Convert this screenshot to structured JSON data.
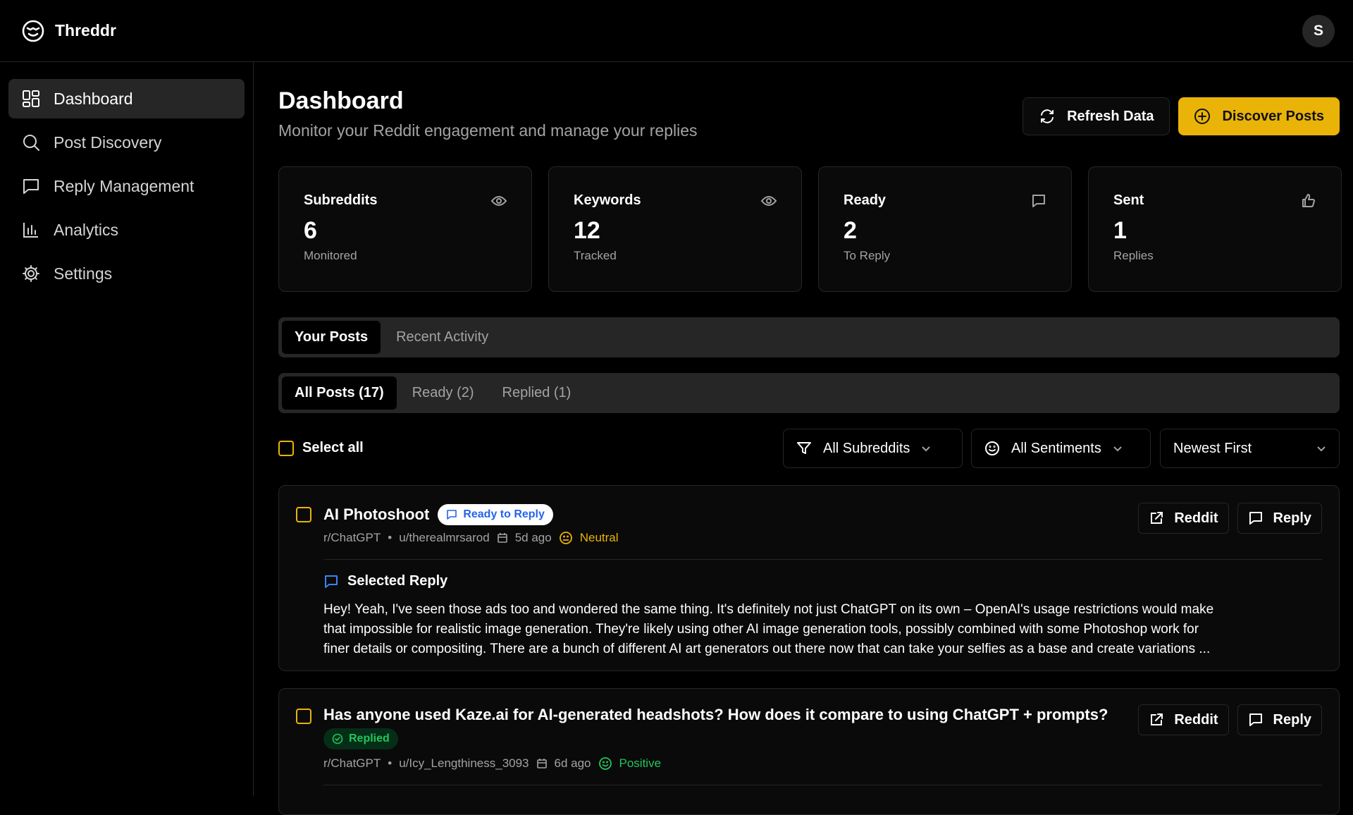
{
  "app": {
    "name": "Threddr",
    "avatar_initial": "S"
  },
  "sidebar": {
    "items": [
      {
        "label": "Dashboard",
        "icon": "dashboard-icon",
        "active": true
      },
      {
        "label": "Post Discovery",
        "icon": "search-icon"
      },
      {
        "label": "Reply Management",
        "icon": "message-icon"
      },
      {
        "label": "Analytics",
        "icon": "bar-chart-icon"
      },
      {
        "label": "Settings",
        "icon": "gear-icon"
      }
    ]
  },
  "page": {
    "title": "Dashboard",
    "subtitle": "Monitor your Reddit engagement and manage your replies",
    "refresh_label": "Refresh Data",
    "discover_label": "Discover Posts"
  },
  "stats": [
    {
      "label": "Subreddits",
      "value": "6",
      "sub": "Monitored",
      "icon": "eye-icon"
    },
    {
      "label": "Keywords",
      "value": "12",
      "sub": "Tracked",
      "icon": "eye-icon"
    },
    {
      "label": "Ready",
      "value": "2",
      "sub": "To Reply",
      "icon": "message-icon"
    },
    {
      "label": "Sent",
      "value": "1",
      "sub": "Replies",
      "icon": "thumbs-up-icon"
    }
  ],
  "main_tabs": [
    {
      "label": "Your Posts",
      "active": true
    },
    {
      "label": "Recent Activity"
    }
  ],
  "filter_tabs": [
    {
      "label": "All Posts (17)",
      "active": true
    },
    {
      "label": "Ready (2)"
    },
    {
      "label": "Replied (1)"
    }
  ],
  "toolbar": {
    "select_all": "Select all",
    "subreddit_filter": "All Subreddits",
    "sentiment_filter": "All Sentiments",
    "sort": "Newest First"
  },
  "posts": [
    {
      "title": "AI Photoshoot",
      "status": "Ready to Reply",
      "subreddit": "r/ChatGPT",
      "author": "u/therealmrsarod",
      "age": "5d ago",
      "sentiment": "Neutral",
      "reply_heading": "Selected Reply",
      "reply_text_1": "Hey! Yeah, I've seen those ads too and wondered the same thing. It's definitely not just ChatGPT on its own – OpenAI's usage restrictions would make",
      "reply_text_2": "that impossible for realistic image generation. They're likely using other AI image generation tools, possibly combined with some Photoshop work for",
      "reply_text_3": "finer details or compositing. There are a bunch of different AI art generators out there now that can take your selfies as a base and create variations ...",
      "reddit_label": "Reddit",
      "reply_label": "Reply"
    },
    {
      "title": "Has anyone used Kaze.ai for AI-generated headshots? How does it compare to using ChatGPT + prompts?",
      "status": "Replied",
      "subreddit": "r/ChatGPT",
      "author": "u/Icy_Lengthiness_3093",
      "age": "6d ago",
      "sentiment": "Positive",
      "reddit_label": "Reddit",
      "reply_label": "Reply"
    }
  ],
  "colors": {
    "accent": "#eab308",
    "neutral": "#eab308",
    "positive": "#22c55e",
    "link_blue": "#2563eb"
  }
}
